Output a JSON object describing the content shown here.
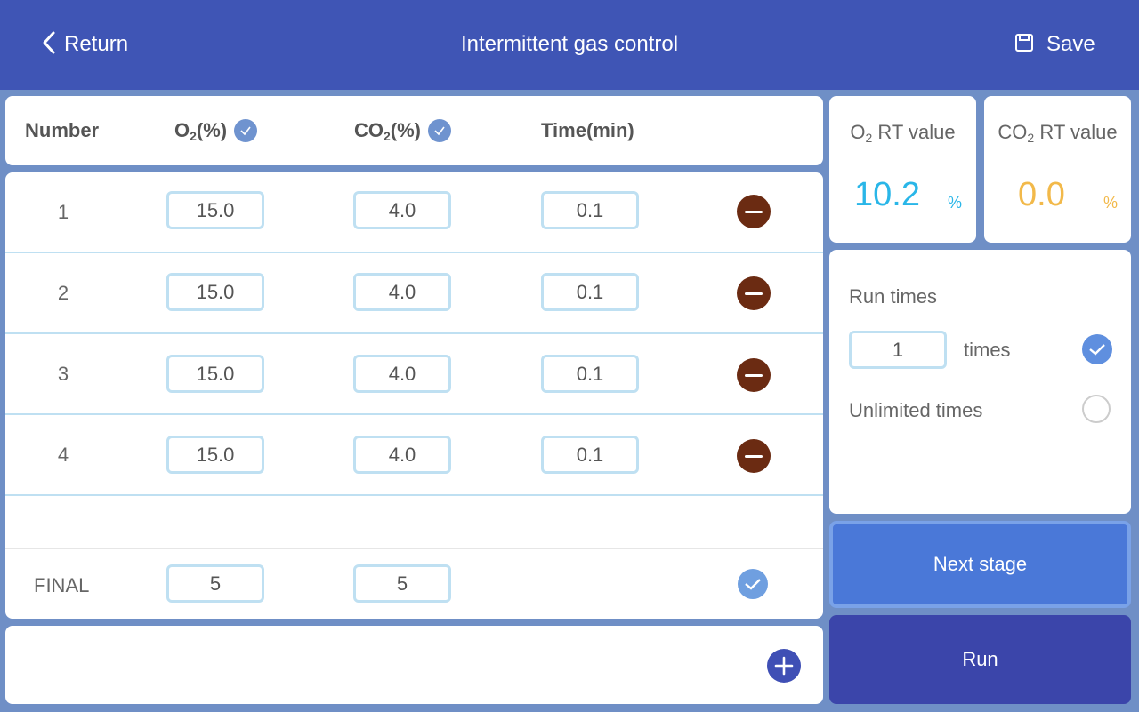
{
  "header": {
    "return_label": "Return",
    "title": "Intermittent gas control",
    "save_label": "Save"
  },
  "table": {
    "columns": {
      "number": "Number",
      "o2": "O",
      "o2_sub": "2",
      "o2_unit": "(%)",
      "co2": "CO",
      "co2_sub": "2",
      "co2_unit": "(%)",
      "time": "Time(min)"
    },
    "rows": [
      {
        "number": "1",
        "o2": "15.0",
        "co2": "4.0",
        "time": "0.1"
      },
      {
        "number": "2",
        "o2": "15.0",
        "co2": "4.0",
        "time": "0.1"
      },
      {
        "number": "3",
        "o2": "15.0",
        "co2": "4.0",
        "time": "0.1"
      },
      {
        "number": "4",
        "o2": "15.0",
        "co2": "4.0",
        "time": "0.1"
      }
    ],
    "final": {
      "label": "FINAL",
      "o2": "5",
      "co2": "5"
    }
  },
  "rt": {
    "o2": {
      "label_main": "O",
      "label_sub": "2",
      "label_rest": " RT value",
      "value": "10.2",
      "unit": "%",
      "color": "#29b6e8"
    },
    "co2": {
      "label_main": "CO",
      "label_sub": "2",
      "label_rest": " RT value",
      "value": "0.0",
      "unit": "%",
      "color": "#f2b94a"
    }
  },
  "run": {
    "run_times_label": "Run times",
    "times_value": "1",
    "times_label": "times",
    "unlimited_label": "Unlimited times",
    "mode": "times"
  },
  "buttons": {
    "next_stage": "Next stage",
    "run": "Run"
  },
  "icons": {
    "back": "chevron-left-icon",
    "save": "save-icon",
    "remove": "minus-circle-icon",
    "check": "check-circle-icon",
    "add": "plus-circle-icon"
  }
}
